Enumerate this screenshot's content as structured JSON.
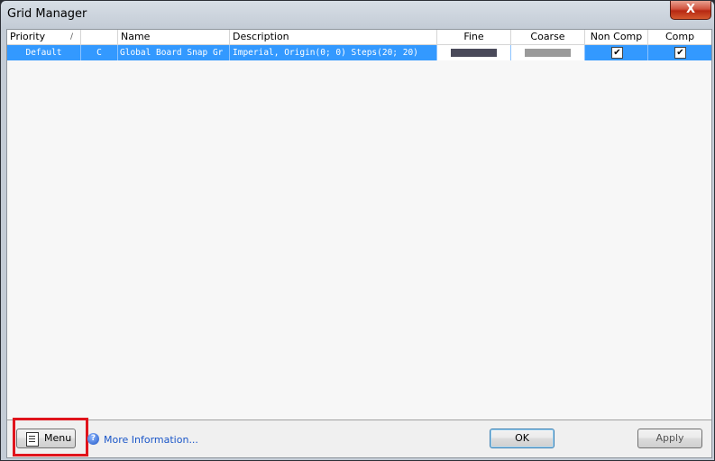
{
  "window": {
    "title": "Grid Manager",
    "close_glyph": "X"
  },
  "table": {
    "columns": [
      "Priority",
      "",
      "Name",
      "Description",
      "Fine",
      "Coarse",
      "Non Comp",
      "Comp"
    ],
    "sort_indicator": "/",
    "rows": [
      {
        "priority": "Default",
        "type": "C",
        "name": "Global Board Snap Gr",
        "description": "Imperial, Origin(0; 0) Steps(20; 20)",
        "fine_color": "#4a4a5a",
        "coarse_color": "#9a9a9a",
        "non_comp": "✔",
        "comp": "✔"
      }
    ]
  },
  "footer": {
    "menu_label": "Menu",
    "more_info_label": "More Information...",
    "ok_label": "OK",
    "apply_label": "Apply"
  },
  "icons": [
    "close-icon",
    "menu-icon",
    "help-icon",
    "checkbox-icon"
  ]
}
